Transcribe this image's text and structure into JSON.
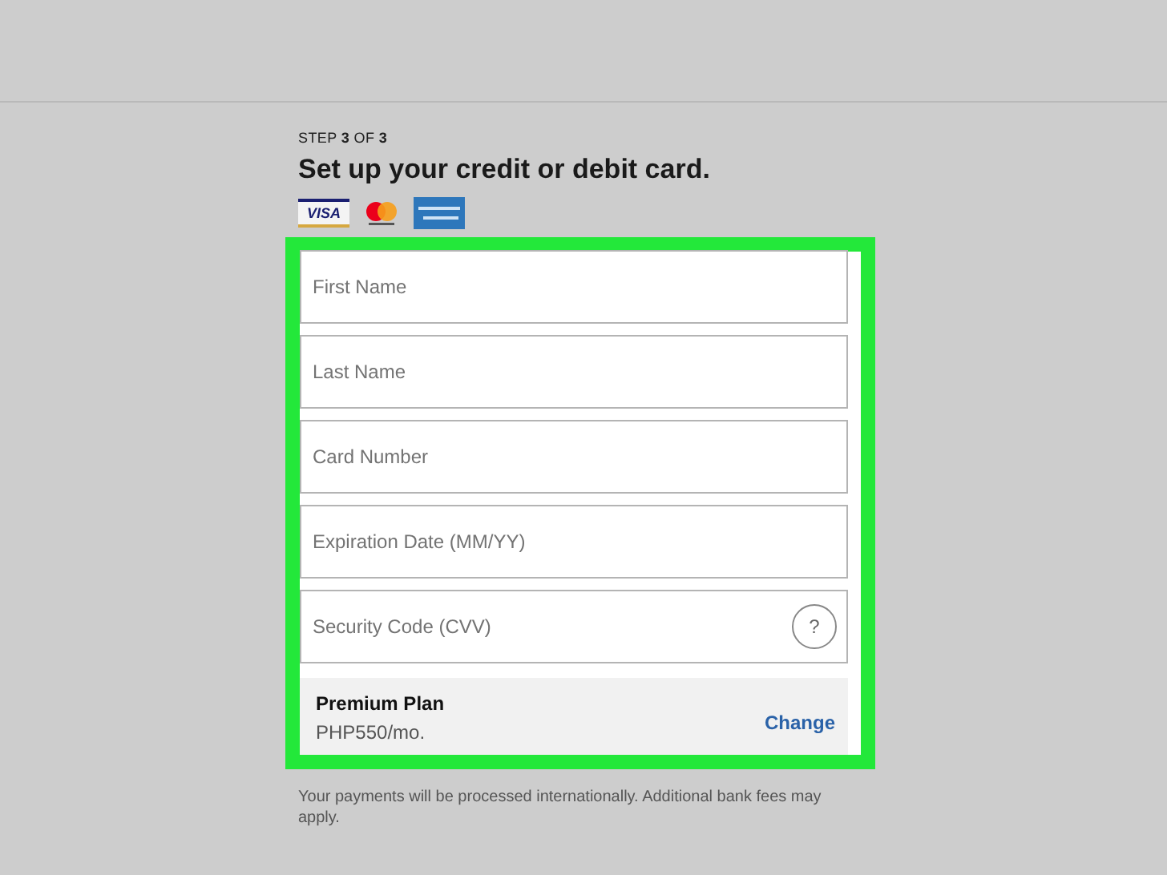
{
  "step": "STEP **3** OF **3**",
  "title": "Set up your credit or debit card.",
  "card_logos": [
    {
      "kind": "visa",
      "text": "VISA"
    },
    {
      "kind": "mastercard"
    },
    {
      "kind": "amex"
    }
  ],
  "fields": [
    {
      "placeholder": "First Name"
    },
    {
      "placeholder": "Last Name"
    },
    {
      "placeholder": "Card Number"
    },
    {
      "placeholder": "Expiration Date (MM/YY)"
    },
    {
      "placeholder": "Security Code (CVV)",
      "help": "?"
    }
  ],
  "plan": {
    "name": "Premium Plan",
    "price": "PHP550/mo.",
    "action": "Change"
  },
  "note": "Your payments will be processed internationally. Additional bank fees may apply."
}
